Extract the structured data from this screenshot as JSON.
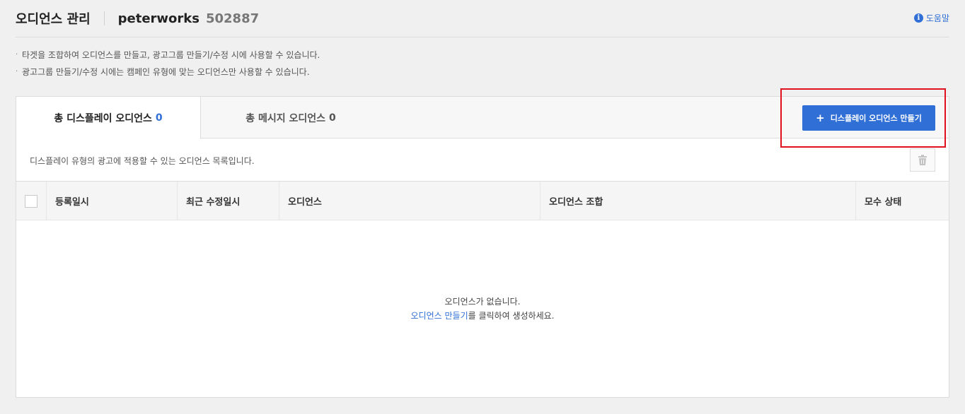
{
  "header": {
    "title": "오디언스 관리",
    "account_name": "peterworks",
    "account_id": "502887",
    "help_label": "도움말"
  },
  "notes": [
    "타겟을 조합하여 오디언스를 만들고, 광고그룹 만들기/수정 시에 사용할 수 있습니다.",
    "광고그룹 만들기/수정 시에는 캠페인 유형에 맞는 오디언스만 사용할 수 있습니다."
  ],
  "note_bullet": "·",
  "tabs": {
    "display": {
      "label": "총 디스플레이 오디언스",
      "count": "0"
    },
    "message": {
      "label": "총 메시지 오디언스",
      "count": "0"
    }
  },
  "create_button": {
    "icon": "plus-icon",
    "label": "디스플레이 오디언스 만들기"
  },
  "list_description": "디스플레이 유형의 광고에 적용할 수 있는 오디언스 목록입니다.",
  "table": {
    "columns": [
      "등록일시",
      "최근 수정일시",
      "오디언스",
      "오디언스 조합",
      "모수 상태"
    ]
  },
  "empty_state": {
    "message": "오디언스가 없습니다.",
    "link_text": "오디언스 만들기",
    "link_suffix": "를 클릭하여 생성하세요."
  },
  "colors": {
    "accent": "#2f6fd6",
    "highlight": "#e0101f"
  }
}
